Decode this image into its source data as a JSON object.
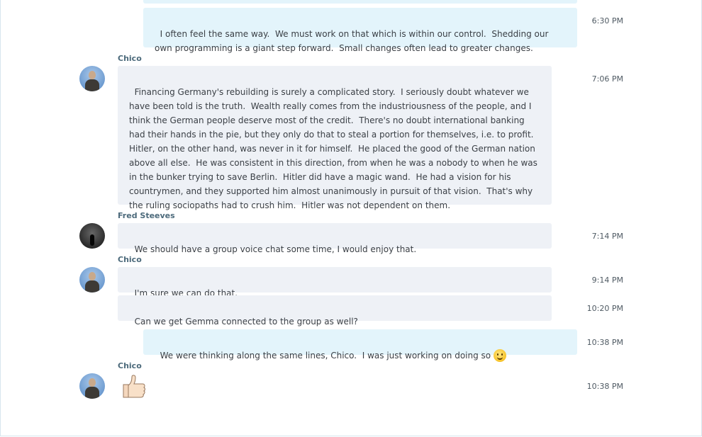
{
  "conversation": {
    "messages": [
      {
        "sender": "",
        "time": "6:30 PM",
        "text": "I often feel the same way.  We must work on that which is within our control.  Shedding our own programming is a giant step forward.  Small changes often lead to greater changes."
      },
      {
        "sender": "Chico",
        "time": "7:06 PM",
        "text": "Financing Germany's rebuilding is surely a complicated story.  I seriously doubt whatever we have been told is the truth.  Wealth really comes from the industriousness of the people, and I think the German people deserve most of the credit.  There's no doubt international banking had their hands in the pie, but they only do that to steal a portion for themselves, i.e. to profit.  Hitler, on the other hand, was never in it for himself.  He placed the good of the German nation above all else.  He was consistent in this direction, from when he was a nobody to when he was in the bunker trying to save Berlin.  Hitler did have a magic wand.  He had a vision for his countrymen, and they supported him almost unanimously in pursuit of that vision.  That's why the ruling sociopaths had to crush him.  Hitler was not dependent on them."
      },
      {
        "sender": "Fred Steeves",
        "time": "7:14 PM",
        "text": "We should have a group voice chat some time, I would enjoy that."
      },
      {
        "sender": "Chico",
        "time": "9:14 PM",
        "text": "I'm sure we can do that."
      },
      {
        "sender": "",
        "time": "10:20 PM",
        "text": "Can we get Gemma connected to the group as well?"
      },
      {
        "sender": "",
        "time": "10:38 PM",
        "text": "We were thinking along the same lines, Chico.  I was just working on doing so",
        "emoji": "smile-emoji"
      },
      {
        "sender": "Chico",
        "time": "10:38 PM",
        "emoji": "thumbs-up-emoji"
      }
    ]
  },
  "colors": {
    "incoming_bubble": "#eef1f6",
    "outgoing_bubble": "#e3f4fb",
    "sender_name": "#4c6a7b"
  }
}
